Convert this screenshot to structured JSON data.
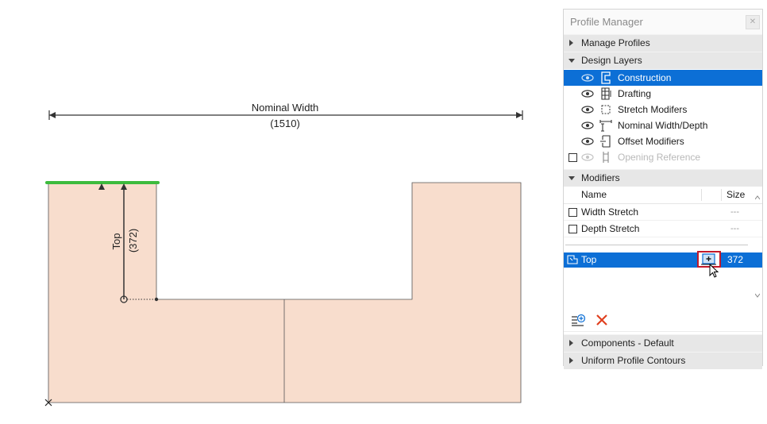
{
  "drawing": {
    "nominal_width_label": "Nominal Width",
    "nominal_width_value": "(1510)",
    "top_label": "Top",
    "top_value": "(372)",
    "fill_color": "#f8ddcd",
    "edge_highlight_color": "#3dbb3d"
  },
  "panel": {
    "title": "Profile Manager",
    "close_icon": "close-icon",
    "sections": {
      "manage_profiles": "Manage Profiles",
      "design_layers": "Design Layers",
      "modifiers": "Modifiers",
      "components": "Components - Default",
      "uniform_contours": "Uniform Profile Contours"
    },
    "layers": [
      {
        "name": "Construction",
        "selected": true
      },
      {
        "name": "Drafting"
      },
      {
        "name": "Stretch Modifers"
      },
      {
        "name": "Nominal Width/Depth"
      },
      {
        "name": "Offset Modifiers"
      },
      {
        "name": "Opening Reference",
        "disabled": true
      }
    ],
    "modifiers_table": {
      "col_name": "Name",
      "col_size": "Size",
      "rows": [
        {
          "name": "Width Stretch",
          "size": "---"
        },
        {
          "name": "Depth Stretch",
          "size": "---"
        }
      ],
      "selected_row": {
        "name": "Top",
        "size": "372"
      }
    },
    "accent_color": "#0c6fd6",
    "delete_color": "#e0401f"
  }
}
